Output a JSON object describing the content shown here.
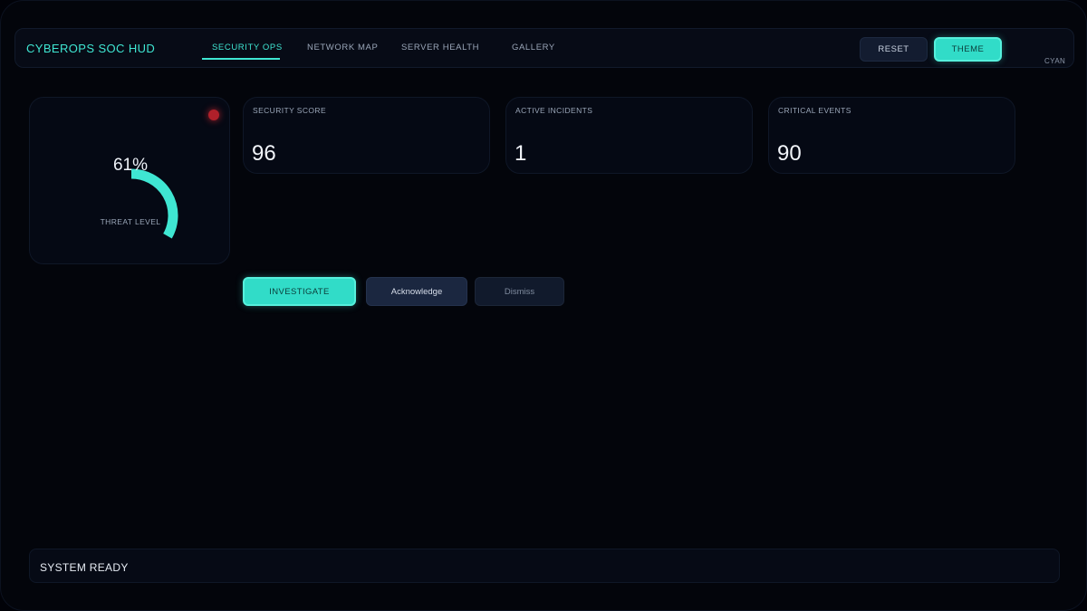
{
  "header": {
    "brand": "CYBEROPS SOC HUD",
    "tabs": [
      {
        "label": "SECURITY OPS",
        "active": true
      },
      {
        "label": "NETWORK MAP",
        "active": false
      },
      {
        "label": "SERVER HEALTH",
        "active": false
      },
      {
        "label": "GALLERY",
        "active": false
      }
    ],
    "reset_label": "RESET",
    "theme_label": "THEME",
    "theme_name": "CYAN"
  },
  "gauge": {
    "value_text": "61%",
    "value": 61,
    "label": "THREAT LEVEL",
    "status": "alert"
  },
  "stats": [
    {
      "label": "SECURITY SCORE",
      "value": "96"
    },
    {
      "label": "ACTIVE INCIDENTS",
      "value": "1"
    },
    {
      "label": "CRITICAL EVENTS",
      "value": "90"
    }
  ],
  "actions": {
    "investigate": "INVESTIGATE",
    "acknowledge": "Acknowledge",
    "dismiss": "Dismiss"
  },
  "status_bar": {
    "text": "SYSTEM READY"
  },
  "colors": {
    "accent": "#3fe6d2",
    "alert": "#b0202a",
    "background": "#03050b"
  }
}
